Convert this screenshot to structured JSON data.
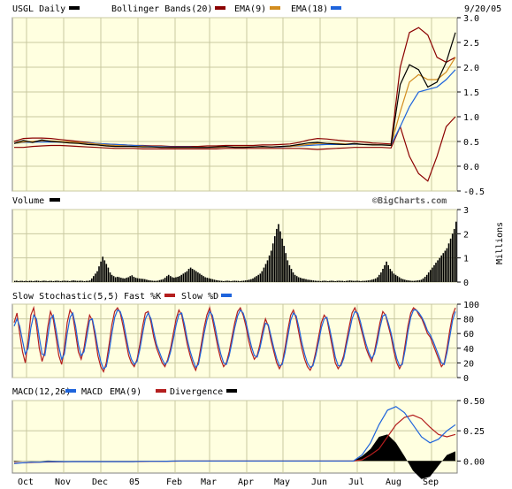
{
  "colors": {
    "plot_bg": "#ffffe0",
    "grid": "#c8c8a0",
    "border": "#808080",
    "price": "#000000",
    "bollinger": "#8b0000",
    "ema9": "#d28c1e",
    "ema18": "#1e64dc",
    "volume": "#000000",
    "fastk": "#b41e1e",
    "slowd": "#1e64dc",
    "macd": "#1e64dc",
    "macd_ema": "#b41e1e",
    "divergence": "#000000"
  },
  "header": {
    "symbol_label": "USGL Daily",
    "bollinger_label": "Bollinger Bands(20)",
    "ema9_label": "EMA(9)",
    "ema18_label": "EMA(18)",
    "date": "9/20/05"
  },
  "volume_panel": {
    "label": "Volume",
    "watermark": "©BigCharts.com",
    "unit": "Millions"
  },
  "stoch_panel": {
    "label": "Slow Stochastic(5,5)",
    "fastk_label": "Fast %K",
    "slowd_label": "Slow %D"
  },
  "macd_panel": {
    "label": "MACD(12,26)",
    "macd_label": "MACD",
    "ema_label": "EMA(9)",
    "div_label": "Divergence"
  },
  "chart_data": {
    "type": "line",
    "x_months": [
      "Oct",
      "Nov",
      "Dec",
      "05",
      "Feb",
      "Mar",
      "Apr",
      "May",
      "Jun",
      "Jul",
      "Aug",
      "Sep"
    ],
    "price_panel": {
      "ylim": [
        -0.5,
        3.0
      ],
      "yticks": [
        "3.0",
        "2.5",
        "2.0",
        "1.5",
        "1.0",
        "0.5",
        "0.0",
        "-0.5"
      ],
      "close": [
        0.46,
        0.52,
        0.48,
        0.53,
        0.5,
        0.49,
        0.47,
        0.46,
        0.44,
        0.43,
        0.41,
        0.4,
        0.4,
        0.4,
        0.39,
        0.39,
        0.38,
        0.38,
        0.38,
        0.38,
        0.38,
        0.38,
        0.39,
        0.4,
        0.38,
        0.38,
        0.39,
        0.4,
        0.39,
        0.4,
        0.41,
        0.44,
        0.47,
        0.48,
        0.46,
        0.45,
        0.44,
        0.46,
        0.44,
        0.43,
        0.43,
        0.42,
        1.65,
        2.05,
        1.95,
        1.6,
        1.7,
        2.1,
        2.7
      ],
      "bb_upper": [
        0.5,
        0.56,
        0.57,
        0.57,
        0.56,
        0.54,
        0.52,
        0.5,
        0.48,
        0.46,
        0.45,
        0.44,
        0.43,
        0.42,
        0.42,
        0.41,
        0.41,
        0.4,
        0.4,
        0.4,
        0.4,
        0.41,
        0.41,
        0.42,
        0.42,
        0.42,
        0.42,
        0.43,
        0.43,
        0.44,
        0.45,
        0.48,
        0.53,
        0.56,
        0.55,
        0.53,
        0.51,
        0.5,
        0.49,
        0.47,
        0.46,
        0.45,
        2.0,
        2.7,
        2.8,
        2.65,
        2.2,
        2.1,
        2.2
      ],
      "bb_lower": [
        0.38,
        0.38,
        0.4,
        0.41,
        0.42,
        0.42,
        0.41,
        0.4,
        0.39,
        0.38,
        0.37,
        0.36,
        0.36,
        0.36,
        0.35,
        0.35,
        0.35,
        0.35,
        0.35,
        0.35,
        0.35,
        0.35,
        0.35,
        0.36,
        0.36,
        0.36,
        0.36,
        0.36,
        0.36,
        0.36,
        0.36,
        0.36,
        0.35,
        0.34,
        0.35,
        0.36,
        0.37,
        0.38,
        0.38,
        0.38,
        0.38,
        0.37,
        0.8,
        0.2,
        -0.15,
        -0.3,
        0.2,
        0.8,
        1.0
      ],
      "ema9": [
        0.46,
        0.49,
        0.5,
        0.51,
        0.51,
        0.5,
        0.49,
        0.48,
        0.46,
        0.45,
        0.43,
        0.42,
        0.41,
        0.4,
        0.4,
        0.39,
        0.39,
        0.38,
        0.38,
        0.38,
        0.38,
        0.38,
        0.38,
        0.39,
        0.39,
        0.39,
        0.39,
        0.39,
        0.39,
        0.4,
        0.4,
        0.42,
        0.44,
        0.46,
        0.46,
        0.46,
        0.45,
        0.45,
        0.44,
        0.44,
        0.43,
        0.43,
        1.1,
        1.7,
        1.85,
        1.75,
        1.75,
        1.9,
        2.2
      ],
      "ema18": [
        0.46,
        0.48,
        0.49,
        0.49,
        0.49,
        0.49,
        0.49,
        0.48,
        0.47,
        0.46,
        0.45,
        0.44,
        0.43,
        0.42,
        0.41,
        0.4,
        0.4,
        0.39,
        0.39,
        0.39,
        0.38,
        0.38,
        0.38,
        0.39,
        0.39,
        0.39,
        0.39,
        0.39,
        0.39,
        0.39,
        0.4,
        0.41,
        0.42,
        0.43,
        0.44,
        0.44,
        0.44,
        0.44,
        0.44,
        0.44,
        0.43,
        0.43,
        0.8,
        1.2,
        1.5,
        1.55,
        1.6,
        1.75,
        1.95
      ]
    },
    "volume_panel": {
      "ylim": [
        0,
        3
      ],
      "yticks": [
        "3",
        "2",
        "1",
        "0"
      ],
      "values": [
        0.05,
        0.06,
        0.04,
        0.05,
        0.05,
        0.04,
        0.05,
        0.04,
        0.05,
        0.05,
        0.04,
        0.05,
        0.06,
        0.05,
        0.04,
        0.05,
        0.06,
        0.05,
        0.04,
        0.05,
        0.05,
        0.04,
        0.05,
        0.06,
        0.05,
        0.04,
        0.05,
        0.06,
        0.05,
        0.05,
        0.04,
        0.06,
        0.07,
        0.06,
        0.05,
        0.05,
        0.06,
        0.05,
        0.04,
        0.05,
        0.05,
        0.07,
        0.15,
        0.25,
        0.35,
        0.45,
        0.65,
        0.85,
        1.05,
        0.9,
        0.75,
        0.6,
        0.4,
        0.3,
        0.25,
        0.2,
        0.22,
        0.2,
        0.18,
        0.16,
        0.15,
        0.18,
        0.2,
        0.25,
        0.28,
        0.22,
        0.18,
        0.16,
        0.15,
        0.14,
        0.13,
        0.12,
        0.1,
        0.08,
        0.07,
        0.06,
        0.05,
        0.05,
        0.06,
        0.08,
        0.1,
        0.12,
        0.18,
        0.25,
        0.3,
        0.25,
        0.2,
        0.18,
        0.2,
        0.22,
        0.25,
        0.3,
        0.35,
        0.4,
        0.45,
        0.55,
        0.6,
        0.55,
        0.5,
        0.45,
        0.4,
        0.35,
        0.3,
        0.25,
        0.2,
        0.18,
        0.16,
        0.14,
        0.12,
        0.1,
        0.08,
        0.07,
        0.06,
        0.05,
        0.04,
        0.05,
        0.06,
        0.05,
        0.04,
        0.05,
        0.06,
        0.05,
        0.05,
        0.04,
        0.05,
        0.06,
        0.07,
        0.08,
        0.1,
        0.12,
        0.15,
        0.2,
        0.25,
        0.3,
        0.35,
        0.45,
        0.6,
        0.75,
        0.9,
        1.1,
        1.3,
        1.6,
        1.9,
        2.2,
        2.4,
        2.1,
        1.8,
        1.5,
        1.2,
        0.9,
        0.7,
        0.55,
        0.4,
        0.3,
        0.25,
        0.2,
        0.18,
        0.15,
        0.14,
        0.12,
        0.1,
        0.09,
        0.08,
        0.07,
        0.06,
        0.05,
        0.05,
        0.04,
        0.05,
        0.06,
        0.05,
        0.04,
        0.05,
        0.06,
        0.05,
        0.04,
        0.05,
        0.06,
        0.05,
        0.05,
        0.04,
        0.05,
        0.06,
        0.07,
        0.06,
        0.05,
        0.05,
        0.06,
        0.05,
        0.04,
        0.05,
        0.05,
        0.06,
        0.07,
        0.08,
        0.1,
        0.12,
        0.15,
        0.2,
        0.3,
        0.4,
        0.55,
        0.7,
        0.85,
        0.7,
        0.55,
        0.45,
        0.35,
        0.3,
        0.25,
        0.2,
        0.15,
        0.12,
        0.1,
        0.08,
        0.07,
        0.06,
        0.05,
        0.05,
        0.06,
        0.07,
        0.08,
        0.1,
        0.15,
        0.22,
        0.3,
        0.4,
        0.5,
        0.6,
        0.7,
        0.8,
        0.9,
        1.0,
        1.1,
        1.2,
        1.3,
        1.4,
        1.6,
        1.8,
        2.0,
        2.2,
        2.5
      ],
      "peaks_note": ""
    },
    "stoch_panel": {
      "ylim": [
        0,
        100
      ],
      "yticks": [
        "100",
        "80",
        "60",
        "40",
        "20",
        "0"
      ],
      "fastk": [
        75,
        88,
        60,
        35,
        20,
        50,
        85,
        95,
        70,
        40,
        22,
        35,
        68,
        90,
        80,
        55,
        30,
        18,
        40,
        75,
        92,
        85,
        60,
        35,
        25,
        40,
        65,
        85,
        78,
        55,
        30,
        15,
        8,
        20,
        45,
        72,
        90,
        95,
        88,
        70,
        50,
        30,
        20,
        15,
        25,
        45,
        70,
        88,
        90,
        75,
        55,
        40,
        30,
        20,
        15,
        25,
        40,
        60,
        80,
        92,
        85,
        65,
        45,
        30,
        18,
        10,
        22,
        45,
        68,
        85,
        95,
        80,
        60,
        40,
        25,
        15,
        20,
        35,
        55,
        75,
        90,
        95,
        85,
        70,
        50,
        35,
        25,
        30,
        45,
        65,
        80,
        70,
        50,
        35,
        20,
        12,
        20,
        40,
        65,
        85,
        92,
        80,
        60,
        40,
        25,
        15,
        10,
        18,
        35,
        55,
        75,
        85,
        80,
        60,
        40,
        20,
        12,
        18,
        30,
        50,
        70,
        88,
        95,
        85,
        70,
        55,
        40,
        30,
        22,
        35,
        55,
        75,
        90,
        85,
        70,
        55,
        35,
        20,
        12,
        20,
        45,
        70,
        88,
        95,
        92,
        85,
        80,
        70,
        60,
        55,
        45,
        35,
        25,
        15,
        20,
        40,
        65,
        85,
        95
      ],
      "slowd": [
        70,
        80,
        70,
        50,
        32,
        40,
        68,
        85,
        80,
        55,
        32,
        30,
        55,
        80,
        85,
        65,
        42,
        25,
        32,
        60,
        82,
        88,
        70,
        45,
        30,
        35,
        55,
        78,
        80,
        62,
        40,
        22,
        12,
        15,
        35,
        60,
        82,
        92,
        90,
        78,
        58,
        38,
        25,
        18,
        22,
        38,
        60,
        80,
        88,
        80,
        62,
        45,
        35,
        25,
        18,
        22,
        35,
        52,
        72,
        86,
        88,
        72,
        52,
        36,
        24,
        14,
        18,
        38,
        60,
        78,
        90,
        85,
        68,
        48,
        32,
        20,
        18,
        30,
        48,
        68,
        84,
        92,
        88,
        76,
        58,
        42,
        30,
        28,
        40,
        58,
        74,
        72,
        56,
        40,
        26,
        16,
        18,
        34,
        56,
        78,
        88,
        84,
        68,
        48,
        32,
        20,
        14,
        16,
        30,
        48,
        68,
        80,
        82,
        66,
        48,
        28,
        16,
        16,
        26,
        44,
        62,
        80,
        90,
        88,
        76,
        60,
        46,
        34,
        26,
        32,
        48,
        68,
        84,
        86,
        74,
        60,
        42,
        26,
        16,
        18,
        38,
        62,
        82,
        92,
        92,
        88,
        82,
        74,
        64,
        58,
        50,
        40,
        30,
        20,
        18,
        34,
        56,
        78,
        90
      ]
    },
    "macd_panel": {
      "ylim": [
        -0.1,
        0.5
      ],
      "yticks": [
        "0.50",
        "0.25",
        "0.00"
      ],
      "macd": [
        -0.02,
        -0.015,
        -0.01,
        -0.01,
        -0.005,
        -0.005,
        -0.005,
        -0.005,
        -0.005,
        -0.005,
        -0.005,
        -0.005,
        -0.005,
        -0.005,
        -0.005,
        -0.003,
        -0.003,
        -0.003,
        -0.002,
        0.0,
        0.0,
        0.0,
        0.0,
        0.0,
        0.0,
        0.0,
        0.0,
        0.0,
        0.0,
        0.0,
        0.0,
        0.0,
        0.0,
        0.0,
        0.0,
        0.0,
        0.0,
        0.0,
        0.0,
        0.0,
        0.0,
        0.05,
        0.15,
        0.3,
        0.42,
        0.45,
        0.4,
        0.3,
        0.2,
        0.15,
        0.18,
        0.25,
        0.3
      ],
      "ema": [
        -0.015,
        -0.015,
        -0.012,
        -0.01,
        -0.008,
        -0.007,
        -0.006,
        -0.005,
        -0.005,
        -0.005,
        -0.005,
        -0.005,
        -0.005,
        -0.005,
        -0.005,
        -0.004,
        -0.003,
        -0.003,
        -0.002,
        -0.001,
        0.0,
        0.0,
        0.0,
        0.0,
        0.0,
        0.0,
        0.0,
        0.0,
        0.0,
        0.0,
        0.0,
        0.0,
        0.0,
        0.0,
        0.0,
        0.0,
        0.0,
        0.0,
        0.0,
        0.0,
        0.0,
        0.01,
        0.05,
        0.1,
        0.2,
        0.3,
        0.36,
        0.38,
        0.35,
        0.28,
        0.22,
        0.2,
        0.22
      ],
      "divergence": [
        -0.005,
        0.0,
        0.002,
        0.0,
        0.003,
        0.002,
        0.001,
        0.0,
        0.0,
        0.0,
        0.0,
        0.0,
        0.0,
        0.0,
        0.0,
        0.001,
        0.0,
        0.0,
        0.0,
        0.001,
        0.0,
        0.0,
        0.0,
        0.0,
        0.0,
        0.0,
        0.0,
        0.0,
        0.0,
        0.0,
        0.0,
        0.0,
        0.0,
        0.0,
        0.0,
        0.0,
        0.0,
        0.0,
        0.0,
        0.0,
        0.0,
        0.04,
        0.1,
        0.2,
        0.22,
        0.15,
        0.04,
        -0.08,
        -0.15,
        -0.13,
        -0.04,
        0.05,
        0.08
      ]
    }
  }
}
